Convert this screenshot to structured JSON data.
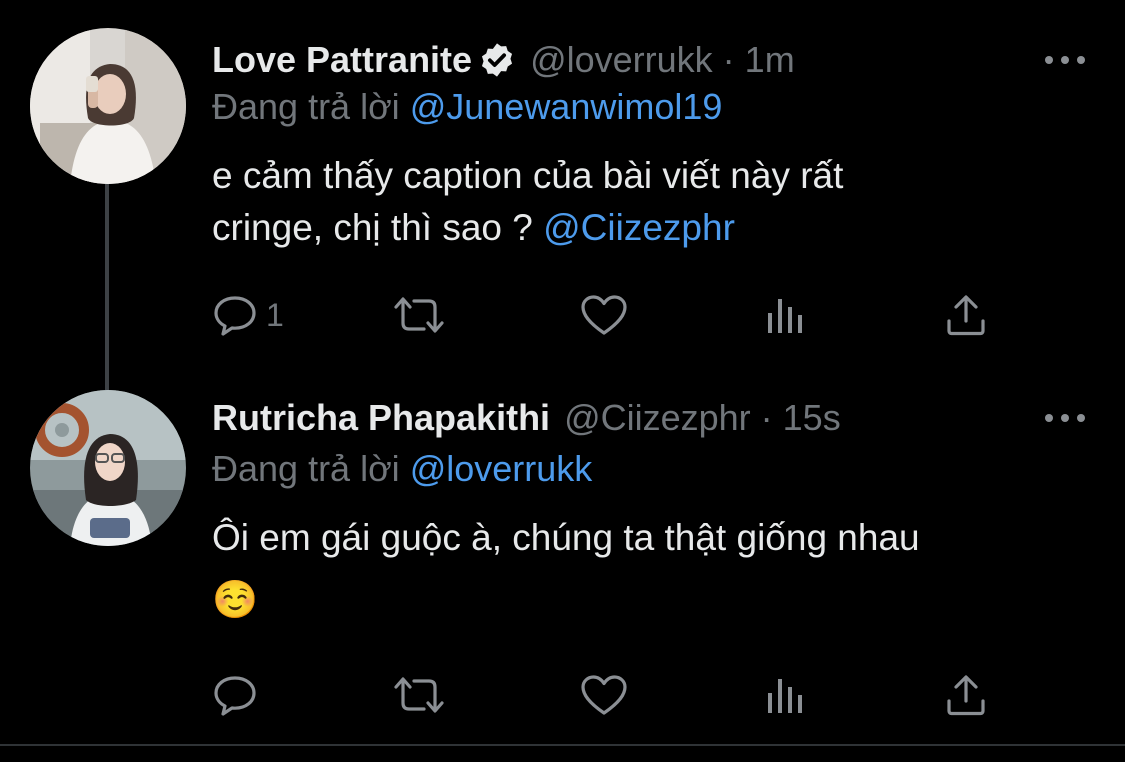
{
  "tweets": [
    {
      "display_name": "Love Pattranite",
      "verified": true,
      "handle": "@loverrukk",
      "separator": "·",
      "time": "1m",
      "replying_prefix": "Đang trả lời",
      "replying_to": "@Junewanwimol19",
      "text_line1": "e cảm thấy caption của bài viết này rất",
      "text_line2": "cringe, chị thì sao ?",
      "text_mention": "@Ciizezphr",
      "reply_count": "1",
      "avatar": "avatar-photo-woman-white-shirt"
    },
    {
      "display_name": "Rutricha Phapakithi",
      "verified": false,
      "handle": "@Ciizezphr",
      "separator": "·",
      "time": "15s",
      "replying_prefix": "Đang trả lời",
      "replying_to": "@loverrukk",
      "text_line1": "Ôi em gái guộc à, chúng ta thật giống nhau",
      "text_emoji": "☺️",
      "reply_count": "",
      "avatar": "avatar-photo-woman-pretzel"
    }
  ],
  "icons": {
    "reply": "reply-icon",
    "retweet": "retweet-icon",
    "like": "heart-icon",
    "analytics": "analytics-icon",
    "share": "share-icon",
    "more": "more-options-icon",
    "verified": "verified-badge-icon"
  },
  "colors": {
    "background": "#000000",
    "text": "#e7e9ea",
    "secondary": "#71767b",
    "link": "#4d9bec",
    "divider": "#2f3336"
  }
}
